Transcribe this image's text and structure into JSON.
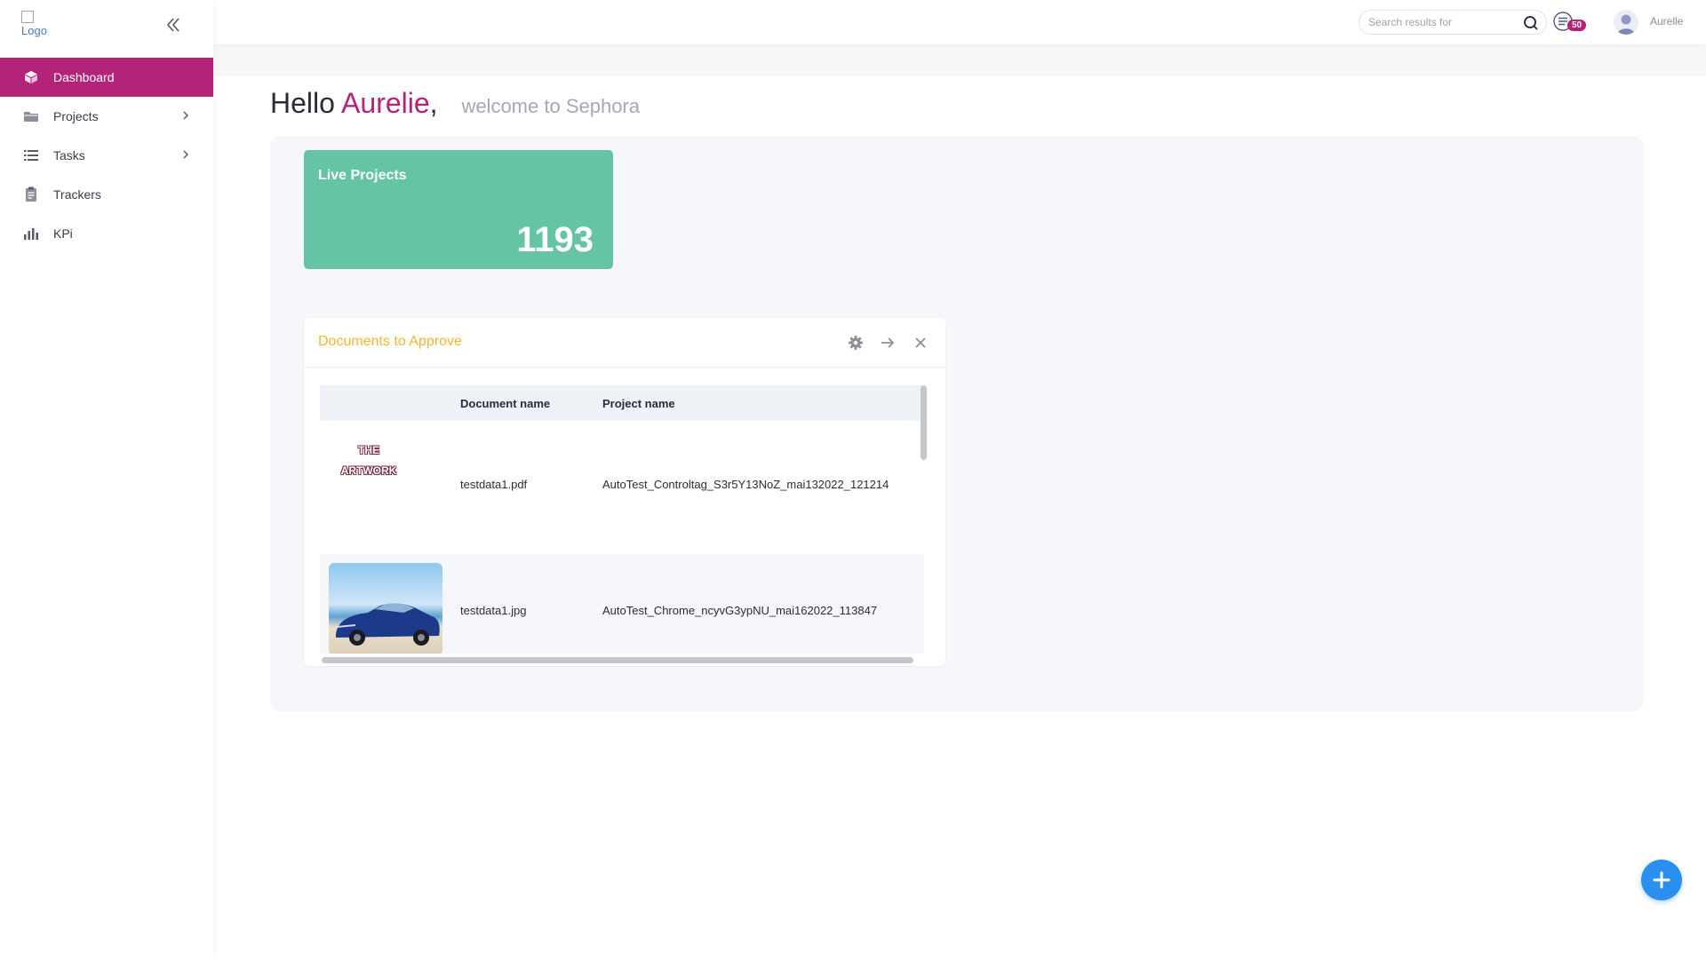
{
  "app": {
    "logo_alt": "Logo"
  },
  "topbar": {
    "search_placeholder": "Search results for",
    "notification_count": "50",
    "username": "Aurelle"
  },
  "sidebar": {
    "items": [
      {
        "label": "Dashboard",
        "icon": "cube-icon",
        "active": true,
        "has_submenu": false
      },
      {
        "label": "Projects",
        "icon": "folder-icon",
        "active": false,
        "has_submenu": true
      },
      {
        "label": "Tasks",
        "icon": "list-icon",
        "active": false,
        "has_submenu": true
      },
      {
        "label": "Trackers",
        "icon": "clipboard-icon",
        "active": false,
        "has_submenu": false
      },
      {
        "label": "KPi",
        "icon": "bar-chart-icon",
        "active": false,
        "has_submenu": false
      }
    ]
  },
  "greeting": {
    "hello": "Hello",
    "name": "Aurelie",
    "comma": ",",
    "welcome": "welcome to Sephora"
  },
  "live_projects": {
    "title": "Live Projects",
    "count": "1193"
  },
  "documents_widget": {
    "title": "Documents to Approve",
    "columns": [
      "Document name",
      "Project name"
    ],
    "rows": [
      {
        "thumbnail_text": [
          "THE",
          "ARTWORK"
        ],
        "document": "testdata1.pdf",
        "project": "AutoTest_Controltag_S3r5Y13NoZ_mai132022_121214"
      },
      {
        "thumbnail": "car-photo",
        "document": "testdata1.jpg",
        "project": "AutoTest_Chrome_ncyvG3ypNU_mai162022_113847"
      }
    ]
  },
  "colors": {
    "brand": "#b4237a",
    "live_card": "#65c3a6",
    "widget_title": "#f2b632",
    "fab": "#2b8ff0"
  }
}
